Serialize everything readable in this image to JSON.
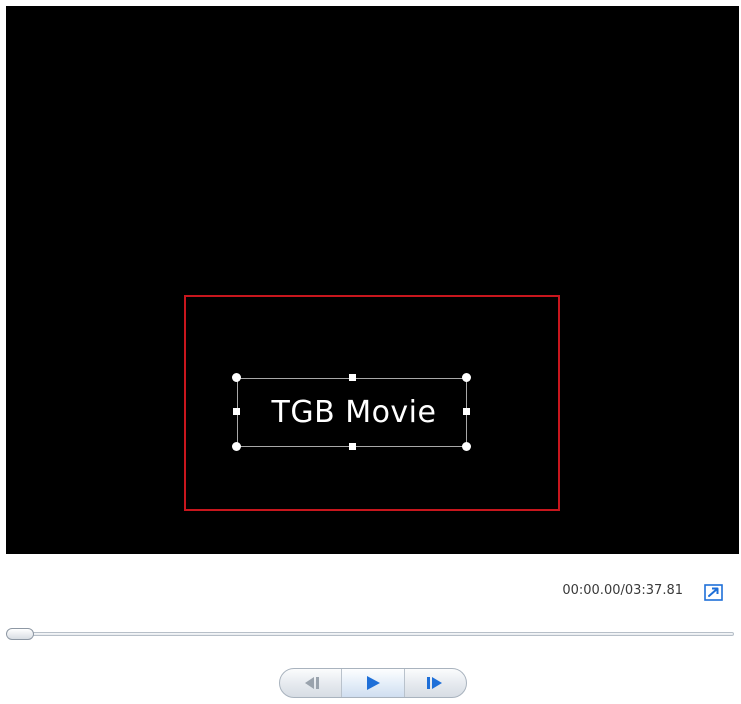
{
  "preview": {
    "title_text": "TGB Movie"
  },
  "playback": {
    "time_display": "00:00.00/03:37.81",
    "position_fraction": 0.0
  },
  "controls": {
    "previous_frame_icon": "previous-frame-icon",
    "play_icon": "play-icon",
    "next_frame_icon": "next-frame-icon",
    "expand_icon": "expand-preview-icon"
  },
  "colors": {
    "preview_background": "#000000",
    "highlight_border": "#c8161d",
    "icon_blue": "#1e6fd8",
    "icon_disabled": "#9aa3ad"
  }
}
